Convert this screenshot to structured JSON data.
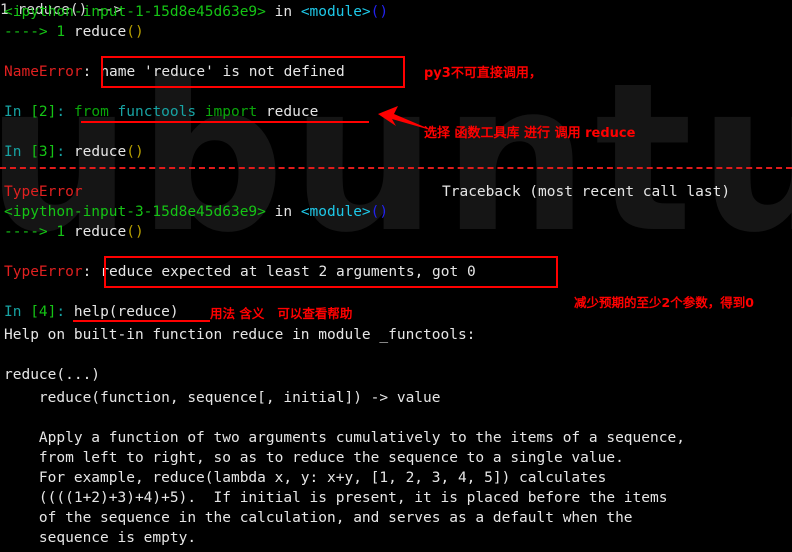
{
  "terminal": {
    "background_color": "#000000",
    "watermark_text": "ubuntu",
    "lines": {
      "l1_frame1": "<ipython-input-1-15d8e45d63e9>",
      "l1_in": " in ",
      "l1_module": "<module>",
      "l1_parens": "()",
      "l2_arrow": "----> 1 ",
      "l2_name": "reduce",
      "l2_parens": "()",
      "nameerror_label": "NameError",
      "nameerror_colon": ":",
      "nameerror_msg": "name 'reduce' is not defined",
      "in2_prompt_in": "In ",
      "in2_prompt_num": "[2]",
      "in2_prompt_colon": ": ",
      "in2_kw_from": "from",
      "in2_mod": " functools ",
      "in2_kw_import": "import",
      "in2_target": " reduce",
      "in3_prompt_in": "In ",
      "in3_prompt_num": "[3]",
      "in3_prompt_colon": ": ",
      "in3_code": "reduce",
      "in3_parens": "()",
      "typeerror_head": "TypeError",
      "traceback_head": "Traceback (most recent call last)",
      "tb_frame": "<ipython-input-3-15d8e45d63e9>",
      "tb_in": " in ",
      "tb_module": "<module>",
      "tb_parens": "()",
      "tb_arrow": "----> 1 ",
      "tb_name": "reduce",
      "tb_parens2": "()",
      "typeerror_label": "TypeError",
      "typeerror_colon": ":",
      "typeerror_msg": "reduce expected at least 2 arguments, got 0",
      "in4_prompt_in": "In ",
      "in4_prompt_num": "[4]",
      "in4_prompt_colon": ": ",
      "in4_code": "help(reduce)",
      "help_title": "Help on built-in function reduce in module _functools:",
      "help_sig_head": "reduce(...)",
      "help_sig": "    reduce(function, sequence[, initial]) -> value",
      "doc_l1": "    Apply a function of two arguments cumulatively to the items of a sequence,",
      "doc_l2": "    from left to right, so as to reduce the sequence to a single value.",
      "doc_l3": "    For example, reduce(lambda x, y: x+y, [1, 2, 3, 4, 5]) calculates",
      "doc_l4": "    ((((1+2)+3)+4)+5).  If initial is present, it is placed before the items",
      "doc_l5": "    of the sequence in the calculation, and serves as a default when the",
      "doc_l6": "    sequence is empty."
    }
  },
  "annotations": {
    "color": "#ff0000",
    "note_py3": "py3不可直接调用，",
    "note_select": "选择 函数工具库 进行 调用 reduce",
    "note_args": "减少预期的至少2个参数，得到0",
    "note_usage": "用法 含义   可以查看帮助"
  }
}
